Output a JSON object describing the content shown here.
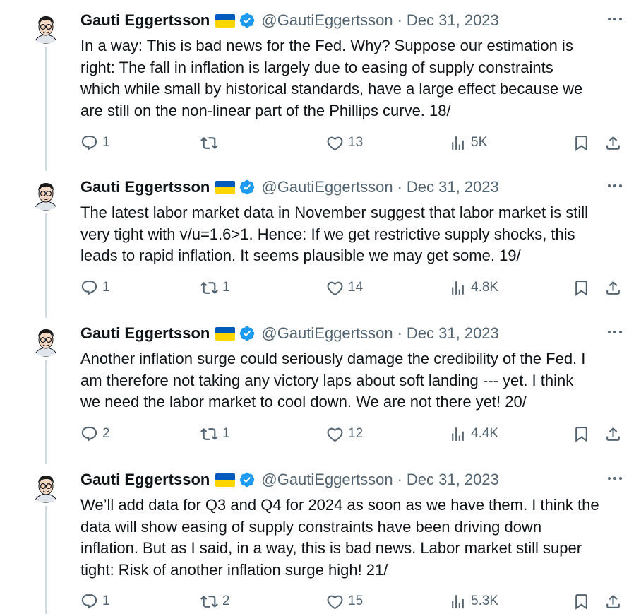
{
  "author": {
    "name": "Gauti Eggertsson",
    "handle": "@GautiEggertsson",
    "verified_color": "#1d9bf0",
    "flag": "ukraine-flag"
  },
  "tweets": [
    {
      "date": "Dec 31, 2023",
      "separator": "·",
      "lines": [
        "In a way: This is bad news for the Fed. Why? Suppose our estimation is",
        "right: The fall in inflation is largely due to easing of supply constraints",
        "which while small by historical standards, have a large effect because we",
        "are still on the non-linear part of the Phillips curve. 18/"
      ],
      "replies": "1",
      "reposts": "",
      "likes": "13",
      "views": "5K"
    },
    {
      "date": "Dec 31, 2023",
      "separator": "·",
      "lines": [
        "The latest labor market data in November suggest that labor market is still",
        "very tight with v/u=1.6>1. Hence: If we get restrictive supply shocks, this",
        "leads to rapid inflation. It seems plausible we may get some. 19/"
      ],
      "replies": "1",
      "reposts": "1",
      "likes": "14",
      "views": "4.8K"
    },
    {
      "date": "Dec 31, 2023",
      "separator": "·",
      "lines": [
        "Another inflation surge could seriously damage the credibility of the Fed. I",
        "am therefore not taking any victory laps about soft landing --- yet. I think",
        "we need the labor market to cool down. We are not there yet! 20/"
      ],
      "replies": "2",
      "reposts": "1",
      "likes": "12",
      "views": "4.4K"
    },
    {
      "date": "Dec 31, 2023",
      "separator": "·",
      "lines": [
        "We’ll add data for Q3 and Q4 for 2024 as soon as we have them. I think the",
        "data will show easing of supply constraints have been driving down",
        "inflation. But as I said, in a way, this is bad news. Labor market still super",
        "tight: Risk of another inflation surge high! 21/"
      ],
      "replies": "1",
      "reposts": "2",
      "likes": "15",
      "views": "5.3K"
    }
  ],
  "colors": {
    "text": "#0f1419",
    "muted": "#536471",
    "thread_line": "#cfd9de",
    "verified": "#1d9bf0"
  }
}
